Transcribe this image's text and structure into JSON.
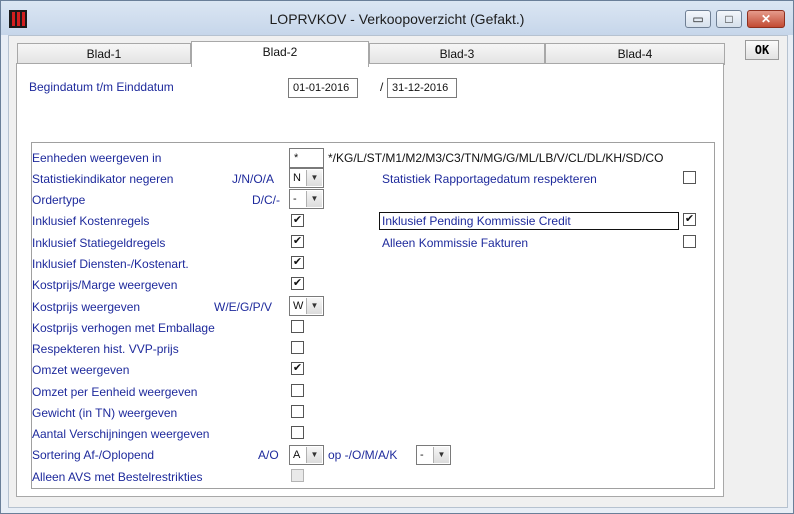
{
  "window": {
    "title": "LOPRVKOV - Verkoopoverzicht (Gefakt.)",
    "minimize_glyph": "▭",
    "maximize_glyph": "□",
    "close_glyph": "✕"
  },
  "tabs": [
    {
      "label": "Blad-1"
    },
    {
      "label": "Blad-2"
    },
    {
      "label": "Blad-3"
    },
    {
      "label": "Blad-4"
    }
  ],
  "ok_label": "OK",
  "dates": {
    "label": "Begindatum t/m Einddatum",
    "begin": "01-01-2016",
    "separator": "/",
    "end": "31-12-2016"
  },
  "eenheden": {
    "label": "Eenheden weergeven in",
    "value": "*",
    "hint": "*/KG/L/ST/M1/M2/M3/C3/TN/MG/G/ML/LB/V/CL/DL/KH/SD/CO"
  },
  "statistiek": {
    "label": "Statistiekindikator negeren",
    "codes": "J/N/O/A",
    "value": "N"
  },
  "ordertype": {
    "label": "Ordertype",
    "codes": "D/C/-",
    "value": "-"
  },
  "kostprijs_weergeven": {
    "label": "Kostprijs weergeven",
    "codes": "W/E/G/P/V",
    "value": "W"
  },
  "sortering": {
    "label": "Sortering Af-/Oplopend",
    "codes": "A/O",
    "value": "A",
    "op_label": "op -/O/M/A/K",
    "op_value": "-"
  },
  "checks_left": [
    {
      "label": "Inklusief Kostenregels",
      "checked": true
    },
    {
      "label": "Inklusief Statiegeldregels",
      "checked": true
    },
    {
      "label": "Inklusief Diensten-/Kostenart.",
      "checked": true
    },
    {
      "label": "Kostprijs/Marge weergeven",
      "checked": true
    },
    {
      "label": "Kostprijs verhogen met Emballage",
      "checked": false
    },
    {
      "label": "Respekteren hist. VVP-prijs",
      "checked": false
    },
    {
      "label": "Omzet weergeven",
      "checked": true
    },
    {
      "label": "Omzet per Eenheid weergeven",
      "checked": false
    },
    {
      "label": "Gewicht (in TN) weergeven",
      "checked": false
    },
    {
      "label": "Aantal Verschijningen weergeven",
      "checked": false
    },
    {
      "label": "Alleen AVS met Bestelrestrikties",
      "checked": false,
      "disabled": true
    }
  ],
  "checks_right": [
    {
      "label": "Statistiek Rapportagedatum respekteren",
      "checked": false
    },
    {
      "label": "Inklusief Pending Kommissie Credit",
      "checked": true
    },
    {
      "label": "Alleen Kommissie Fakturen",
      "checked": false
    }
  ],
  "check_mark": "✔",
  "dropdown_glyph": "▼"
}
